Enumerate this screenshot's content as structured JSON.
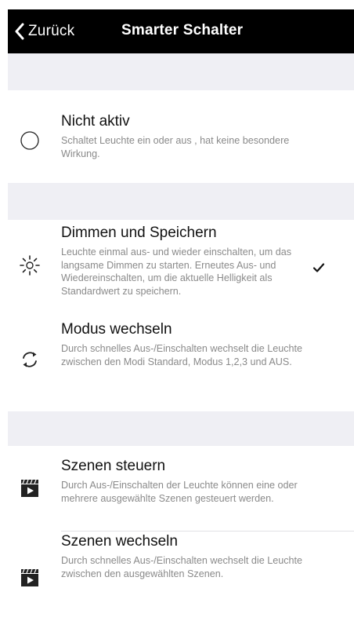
{
  "nav": {
    "back_label": "Zurück",
    "title": "Smarter Schalter"
  },
  "options": [
    {
      "title": "Nicht aktiv",
      "description": "Schaltet Leuchte ein oder aus , hat keine besondere Wirkung.",
      "icon": "radio-circle-icon",
      "selected": false
    },
    {
      "title": "Dimmen und Speichern",
      "description": "Leuchte einmal aus- und wieder einschalten, um das langsame Dimmen zu starten. Erneutes Aus- und Wiedereinschalten, um die aktuelle Helligkeit als Standardwert zu speichern.",
      "icon": "brightness-sun-icon",
      "selected": true
    },
    {
      "title": "Modus wechseln",
      "description": "Durch schnelles Aus-/Einschalten wechselt die Leuchte zwischen den Modi Standard, Modus 1,2,3 und AUS.",
      "icon": "cycle-arrows-icon",
      "selected": false
    },
    {
      "title": "Szenen steuern",
      "description": "Durch Aus-/Einschalten der Leuchte können eine oder mehrere ausgewählte Szenen gesteuert werden.",
      "icon": "clapperboard-icon",
      "selected": false
    },
    {
      "title": "Szenen wechseln",
      "description": "Durch schnelles Aus-/Einschalten wechselt die Leuchte zwischen den ausgewählten Szenen.",
      "icon": "clapperboard-icon",
      "selected": false
    }
  ],
  "colors": {
    "navbar_bg": "#000000",
    "section_bg": "#efeff4",
    "description_text": "#8a8a8a"
  }
}
